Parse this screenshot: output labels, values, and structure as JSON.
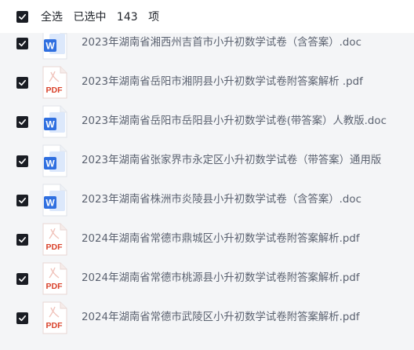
{
  "header": {
    "select_all_label": "全选",
    "selected_prefix": "已选中",
    "selected_count": "143",
    "selected_suffix": "项"
  },
  "files": [
    {
      "name": "2023年湖南省湘西州吉首市小升初数学试卷（含答案）.doc",
      "type": "word",
      "icon_text": "W",
      "checked": true
    },
    {
      "name": "2023年湖南省岳阳市湘阴县小升初数学试卷附答案解析 .pdf",
      "type": "pdf",
      "icon_text": "PDF",
      "checked": true
    },
    {
      "name": "2023年湖南省岳阳市岳阳县小升初数学试卷(带答案）人教版.doc",
      "type": "word",
      "icon_text": "W",
      "checked": true
    },
    {
      "name": "2023年湖南省张家界市永定区小升初数学试卷（带答案）通用版",
      "type": "word",
      "icon_text": "W",
      "checked": true
    },
    {
      "name": "2023年湖南省株洲市炎陵县小升初数学试卷（含答案）.doc",
      "type": "word",
      "icon_text": "W",
      "checked": true
    },
    {
      "name": "2024年湖南省常德市鼎城区小升初数学试卷附答案解析.pdf",
      "type": "pdf",
      "icon_text": "PDF",
      "checked": true
    },
    {
      "name": "2024年湖南省常德市桃源县小升初数学试卷附答案解析.pdf",
      "type": "pdf",
      "icon_text": "PDF",
      "checked": true
    },
    {
      "name": "2024年湖南省常德市武陵区小升初数学试卷附答案解析.pdf",
      "type": "pdf",
      "icon_text": "PDF",
      "checked": true
    }
  ],
  "colors": {
    "checkbox": "#1a1d24",
    "word_blue": "#2f6fe0",
    "pdf_red": "#d9422b",
    "text": "#5b6270"
  }
}
